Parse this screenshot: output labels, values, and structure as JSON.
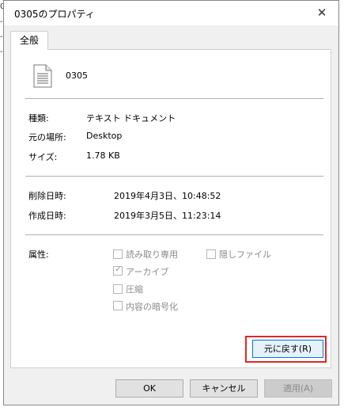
{
  "edge_chars": [
    "0",
    "-l",
    "-l",
    "-l"
  ],
  "window": {
    "title": "0305のプロパティ",
    "close_label": "✕"
  },
  "tabs": {
    "general": "全般"
  },
  "file": {
    "icon": "text-document-icon",
    "name": "0305"
  },
  "general": {
    "type_label": "種類:",
    "type_value": "テキスト ドキュメント",
    "location_label": "元の場所:",
    "location_value": "Desktop",
    "size_label": "サイズ:",
    "size_value": "1.78 KB"
  },
  "dates": {
    "deleted_label": "削除日時:",
    "deleted_value": "2019年4月3日、10:48:52",
    "created_label": "作成日時:",
    "created_value": "2019年3月5日、11:23:14"
  },
  "attributes": {
    "label": "属性:",
    "readonly": "読み取り専用",
    "hidden": "隠しファイル",
    "archive": "アーカイブ",
    "compress": "圧縮",
    "encrypt": "内容の暗号化",
    "archive_checked": true
  },
  "buttons": {
    "restore": "元に戻す(R)",
    "ok": "OK",
    "cancel": "キャンセル",
    "apply": "適用(A)"
  },
  "colors": {
    "highlight": "#e32626",
    "focus": "#0078d7"
  }
}
